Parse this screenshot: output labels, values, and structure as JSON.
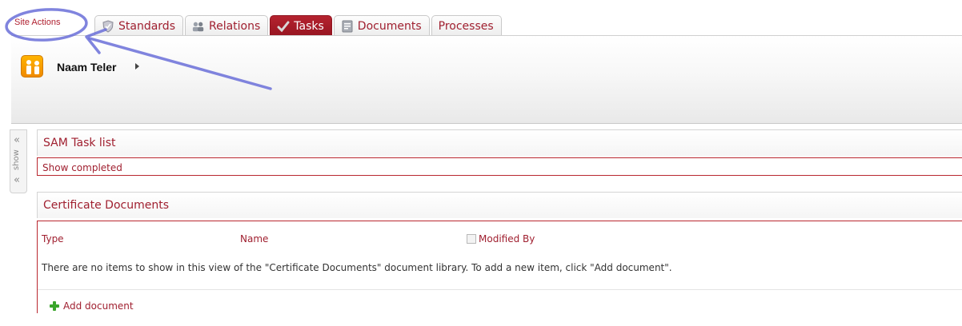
{
  "top": {
    "site_actions": "Site Actions",
    "tabs": [
      {
        "label": "Standards",
        "icon": "shield-icon",
        "active": false
      },
      {
        "label": "Relations",
        "icon": "people-icon",
        "active": false
      },
      {
        "label": "Tasks",
        "icon": "checkmark-icon",
        "active": true
      },
      {
        "label": "Documents",
        "icon": "document-icon",
        "active": false
      },
      {
        "label": "Processes",
        "icon": "",
        "active": false
      }
    ]
  },
  "header": {
    "site_title": "Naam Teler"
  },
  "show_handle": {
    "label": "show"
  },
  "task_list": {
    "title": "SAM Task list",
    "show_completed": "Show completed"
  },
  "certificate_documents": {
    "title": "Certificate Documents",
    "columns": [
      "Type",
      "Name",
      "Modified By"
    ],
    "empty_message": "There are no items to show in this view of the \"Certificate Documents\" document library. To add a new item, click \"Add document\".",
    "add_label": "Add document"
  },
  "colors": {
    "accent": "#a02030",
    "active_tab": "#a81c28",
    "annotation": "#6a6fd8",
    "add_icon": "#3aa52b"
  }
}
